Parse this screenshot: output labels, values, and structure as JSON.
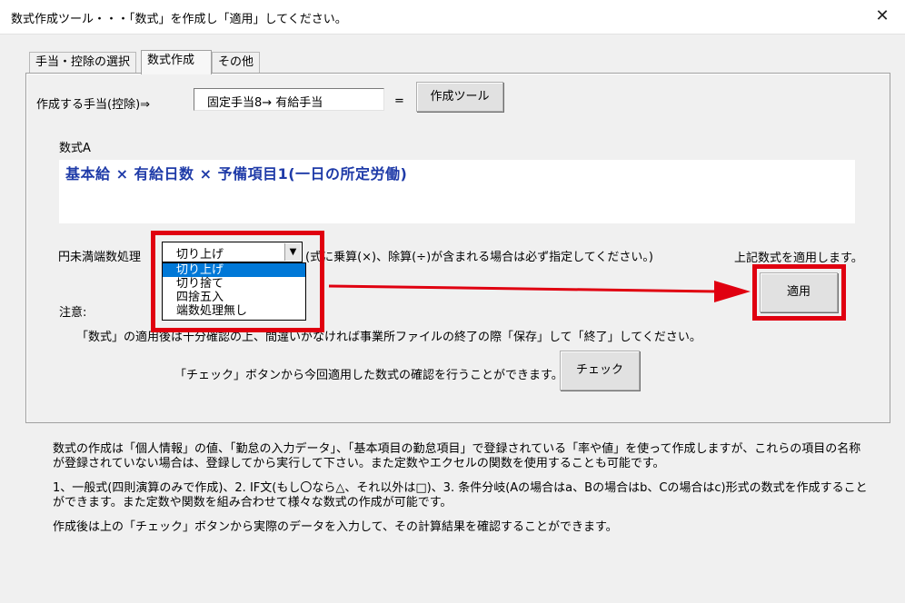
{
  "window": {
    "title": "数式作成ツール・・・「数式」を作成し「適用」してください。"
  },
  "tabs": [
    {
      "label": "手当・控除の選択"
    },
    {
      "label": "数式作成"
    },
    {
      "label": "その他"
    }
  ],
  "row1": {
    "label": "作成する手当(控除)⇒",
    "allowance_value": "固定手当8→ 有給手当",
    "equals": "=",
    "tool_button": "作成ツール"
  },
  "formula": {
    "label": "数式A",
    "expression": "基本給 × 有給日数 × 予備項目1(一日の所定労働)"
  },
  "rounding": {
    "label": "円未満端数処理",
    "selected": "切り上げ",
    "hint": "(式に乗算(×)、除算(÷)が含まれる場合は必ず指定してください。)",
    "options": [
      "切り上げ",
      "切り捨て",
      "四捨五入",
      "端数処理無し"
    ]
  },
  "apply": {
    "hint": "上記数式を適用します。",
    "button": "適用"
  },
  "notes": {
    "label": "注意:",
    "line1": "「数式」の適用後は十分確認の上、間違いがなければ事業所ファイルの終了の際「保存」して「終了」してください。",
    "check_hint": "「チェック」ボタンから今回適用した数式の確認を行うことができます。⇒",
    "check_button": "チェック"
  },
  "description": {
    "para1": "数式の作成は「個人情報」の値、「勤怠の入力データ」、「基本項目の勤怠項目」で登録されている「率や値」を使って作成しますが、これらの項目の名称が登録されていない場合は、登録してから実行して下さい。また定数やエクセルの関数を使用することも可能です。",
    "para2": "1、一般式(四則演算のみで作成)、2. IF文(もし〇なら△、それ以外は□)、3. 条件分岐(Aの場合はa、Bの場合はb、Cの場合はc)形式の数式を作成することができます。また定数や関数を組み合わせて様々な数式の作成が可能です。",
    "para3": "作成後は上の「チェック」ボタンから実際のデータを入力して、その計算結果を確認することができます。"
  },
  "icons": {
    "close": "close-icon",
    "dropdown": "chevron-down-icon",
    "arrow": "arrow-right-icon"
  },
  "colors": {
    "highlight": "#e00010",
    "formula_text": "#1f3ba8",
    "selection": "#0078d7"
  }
}
